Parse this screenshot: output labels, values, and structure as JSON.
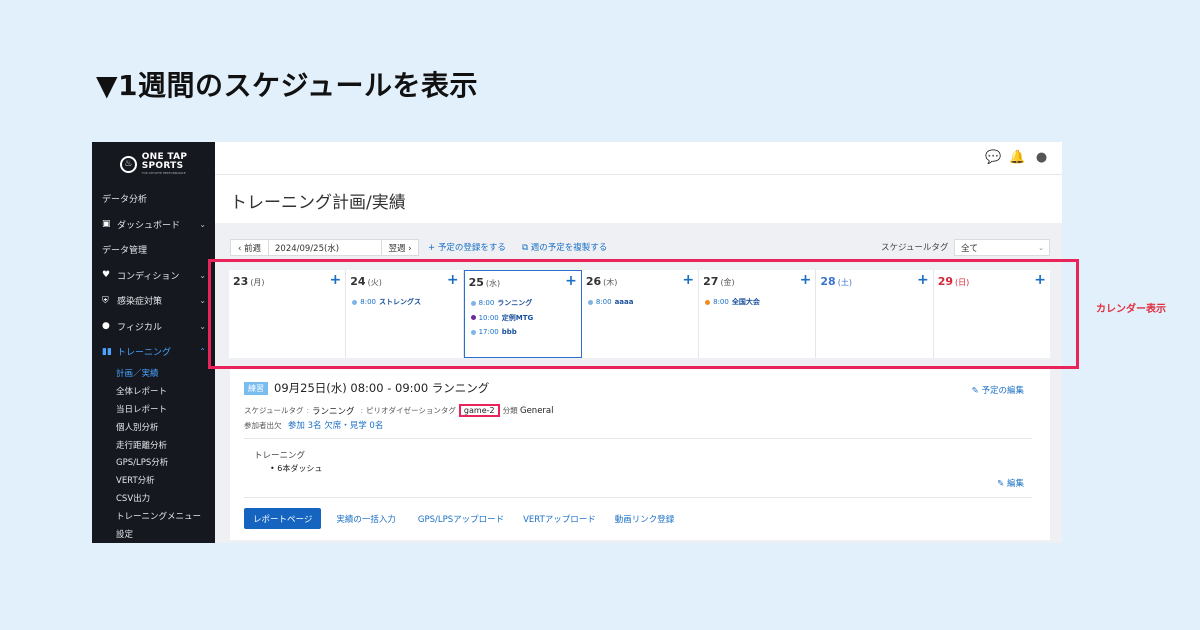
{
  "banner": {
    "title": "▼1週間のスケジュールを表示"
  },
  "brand": {
    "line1": "ONE TAP",
    "line2": "SPORTS",
    "sub": "TOP ATHLETE PERFORMANCE"
  },
  "sidebar": {
    "items": [
      {
        "label": "データ分析",
        "icon": "",
        "chevron": ""
      },
      {
        "label": "ダッシュボード",
        "icon": "id-card-icon",
        "chevron": "⌄"
      },
      {
        "label": "データ管理",
        "icon": "",
        "chevron": ""
      },
      {
        "label": "コンディション",
        "icon": "heart-pulse-icon",
        "chevron": "⌄"
      },
      {
        "label": "感染症対策",
        "icon": "shield-icon",
        "chevron": "⌄"
      },
      {
        "label": "フィジカル",
        "icon": "user-icon",
        "chevron": "⌄"
      },
      {
        "label": "トレーニング",
        "icon": "dumbbell-icon",
        "chevron": "⌃",
        "active": true
      }
    ],
    "sub_items": [
      "計画／実績",
      "全体レポート",
      "当日レポート",
      "個人別分析",
      "走行距離分析",
      "GPS/LPS分析",
      "VERT分析",
      "CSV出力",
      "トレーニングメニュー",
      "設定"
    ],
    "current_sub": "計画／実績"
  },
  "topbar": {
    "icons": [
      "chat-icon",
      "bell-icon",
      "account-icon"
    ]
  },
  "page": {
    "title": "トレーニング計画/実績"
  },
  "toolbar": {
    "prev": "‹ 前週",
    "date": "2024/09/25(水)",
    "next": "翌週 ›",
    "add": "+ 予定の登録をする",
    "copy": "週の予定を複製する",
    "tag_label": "スケジュールタグ",
    "tag_value": "全て"
  },
  "week": {
    "days": [
      {
        "num": "23",
        "wd": "(月)",
        "events": []
      },
      {
        "num": "24",
        "wd": "(火)",
        "events": [
          {
            "time": "8:00",
            "title": "ストレングス",
            "color": "#7fb4e6"
          }
        ]
      },
      {
        "num": "25",
        "wd": "(水)",
        "today": true,
        "events": [
          {
            "time": "8:00",
            "title": "ランニング",
            "color": "#7fb4e6"
          },
          {
            "time": "10:00",
            "title": "定例MTG",
            "color": "#6a2d9e"
          },
          {
            "time": "17:00",
            "title": "bbb",
            "color": "#7fb4e6"
          }
        ]
      },
      {
        "num": "26",
        "wd": "(木)",
        "events": [
          {
            "time": "8:00",
            "title": "aaaa",
            "color": "#7fb4e6"
          }
        ]
      },
      {
        "num": "27",
        "wd": "(金)",
        "events": [
          {
            "time": "8:00",
            "title": "全国大会",
            "color": "#f08a24"
          }
        ]
      },
      {
        "num": "28",
        "wd": "(土)",
        "weekend": "sat",
        "events": []
      },
      {
        "num": "29",
        "wd": "(日)",
        "weekend": "sun",
        "events": []
      }
    ],
    "add_symbol": "+"
  },
  "annotation": {
    "label": "カレンダー表示"
  },
  "detail": {
    "badge": "練習",
    "title": "09月25日(水) 08:00 - 09:00 ランニング",
    "edit": "予定の編集",
    "meta": {
      "tag_label": "スケジュールタグ",
      "tag_value": "ランニング",
      "period_label": "ピリオダイゼーションタグ",
      "period_value": "game-2",
      "class_label": "分類",
      "class_value": "General"
    },
    "attendance": {
      "label": "参加者出欠",
      "value": "参加 3名 欠席・見学 0名"
    },
    "box": {
      "title": "トレーニング",
      "item": "6本ダッシュ",
      "edit": "編集"
    },
    "actions": {
      "primary": "レポートページ",
      "links": [
        "実績の一括入力",
        "GPS/LPSアップロード",
        "VERTアップロード",
        "動画リンク登録"
      ]
    }
  },
  "colors": {
    "accent": "#1565c0",
    "highlight": "#e8245a",
    "sidebar": "#15181f"
  }
}
